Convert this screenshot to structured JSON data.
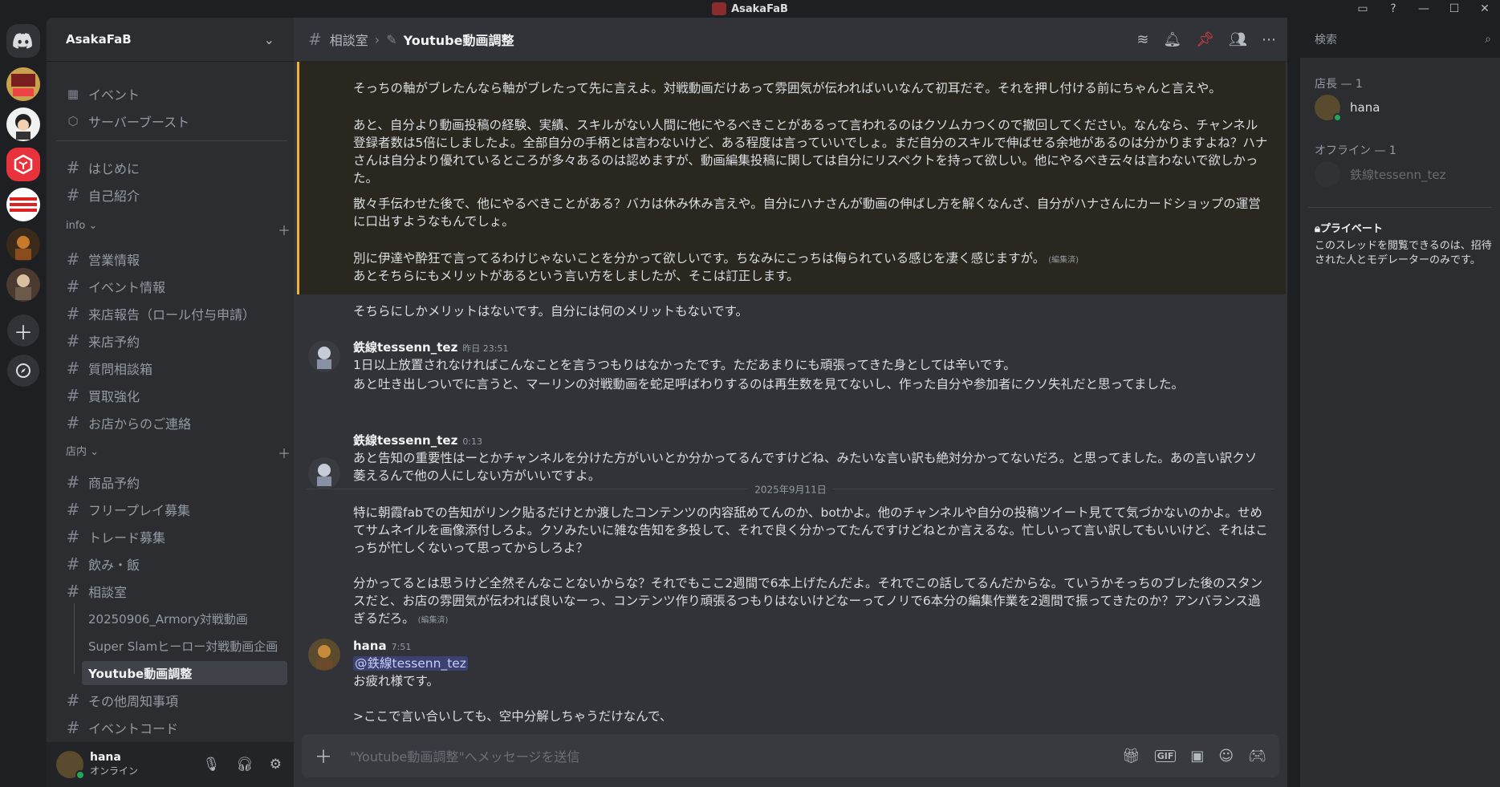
{
  "window": {
    "title": "AsakaFaB"
  },
  "server": {
    "name": "AsakaFaB"
  },
  "sidebar": {
    "top_items": [
      {
        "label": "イベント"
      },
      {
        "label": "サーバーブースト"
      }
    ],
    "channels_top": [
      {
        "label": "はじめに"
      },
      {
        "label": "自己紹介"
      }
    ],
    "cat_info": "info",
    "info_channels": [
      {
        "label": "営業情報"
      },
      {
        "label": "イベント情報"
      },
      {
        "label": "来店報告（ロール付与申請）"
      },
      {
        "label": "来店予約"
      },
      {
        "label": "質問相談箱"
      },
      {
        "label": "買取強化"
      },
      {
        "label": "お店からのご連絡"
      }
    ],
    "cat_store": "店内",
    "store_channels": [
      {
        "label": "商品予約"
      },
      {
        "label": "フリープレイ募集"
      },
      {
        "label": "トレード募集"
      },
      {
        "label": "飲み・飯"
      },
      {
        "label": "相談室"
      }
    ],
    "threads": [
      {
        "label": "20250906_Armory対戦動画"
      },
      {
        "label": "Super Slamヒーロー対戦動画企画"
      },
      {
        "label": "Youtube動画調整"
      }
    ],
    "after_channels": [
      {
        "label": "その他周知事項"
      },
      {
        "label": "イベントコード"
      }
    ]
  },
  "user_panel": {
    "name": "hana",
    "status": "オンライン"
  },
  "header": {
    "parent": "相談室",
    "thread": "Youtube動画調整"
  },
  "search": {
    "placeholder": "検索"
  },
  "messages": {
    "quoted": [
      "そっちの軸がブレたんなら軸がブレたって先に言えよ。対戦動画だけあって雰囲気が伝わればいいなんて初耳だぞ。それを押し付ける前にちゃんと言えや。",
      "あと、自分より動画投稿の経験、実績、スキルがない人間に他にやるべきことがあるって言われるのはクソムカつくので撤回してください。なんなら、チャンネル登録者数は5倍にしましたよ。全部自分の手柄とは言わないけど、ある程度は言っていいでしょ。まだ自分のスキルで伸ばせる余地があるのは分かりますよね？ハナさんは自分より優れているところが多々あるのは認めますが、動画編集投稿に関しては自分にリスペクトを持って欲しい。他にやるべき云々は言わないで欲しかった。",
      "散々手伝わせた後で、他にやるべきことがある？バカは休み休み言えや。自分にハナさんが動画の伸ばし方を解くなんざ、自分がハナさんにカードショップの運営に口出すようなもんでしょ。",
      "別に伊達や酔狂で言ってるわけじゃないことを分かって欲しいです。ちなみにこっちは侮られている感じを凄く感じますが。"
    ],
    "edited_label": "(編集済)",
    "line_a": "あとそちらにもメリットがあるという言い方をしましたが、そこは訂正します。",
    "line_b": "そちらにしかメリットはないです。自分には何のメリットもないです。",
    "m1": {
      "author": "鉄線tessenn_tez",
      "time": "昨日 23:51",
      "lines": [
        "1日以上放置されなければこんなことを言うつもりはなかったです。ただあまりにも頑張ってきた身としては辛いです。",
        "あと吐き出しついでに言うと、マーリンの対戦動画を蛇足呼ばわりするのは再生数を見てないし、作った自分や参加者にクソ失礼だと思ってました。"
      ]
    },
    "date_divider": "2025年9月11日",
    "m2": {
      "author": "鉄線tessenn_tez",
      "time": "0:13",
      "p1": "あと告知の重要性はーとかチャンネルを分けた方がいいとか分かってるんですけどね、みたいな言い訳も絶対分かってないだろ。と思ってました。あの言い訳クソ萎えるんで他の人にしない方がいいですよ。",
      "p2": "特に朝霞fabでの告知がリンク貼るだけとか渡したコンテンツの内容舐めてんのか、botかよ。他のチャンネルや自分の投稿ツイート見てて気づかないのかよ。せめてサムネイルを画像添付しろよ。クソみたいに雑な告知を多投して、それで良く分かってたんですけどねとか言えるな。忙しいって言い訳してもいいけど、それはこっちが忙しくないって思ってからしろよ？",
      "p3": "分かってるとは思うけど全然そんなことないからな？それでもここ2週間で6本上げたんだよ。それでこの話してるんだからな。ていうかそっちのブレた後のスタンスだと、お店の雰囲気が伝われば良いなーっ、コンテンツ作り頑張るつもりはないけどなーってノリで6本分の編集作業を2週間で振ってきたのか？アンバランス過ぎるだろ。"
    },
    "m3": {
      "author": "hana",
      "time": "7:51",
      "mention": "@鉄線tessenn_tez",
      "l1": "お疲れ様です。",
      "l2": ">ここで言い合いしても、空中分解しちゃうだけなんで、"
    }
  },
  "composer": {
    "placeholder": "\"Youtube動画調整\"へメッセージを送信"
  },
  "members": {
    "cat1": "店長 — 1",
    "m1": "hana",
    "cat2": "オフライン — 1",
    "m2": "鉄線tessenn_tez",
    "private_title": "プライベート",
    "private_text": "このスレッドを閲覧できるのは、招待された人とモデレーターのみです。"
  },
  "colors": {
    "accent": "#5865f2",
    "online": "#23a55a",
    "highlight": "#f0b232",
    "danger": "#f23f43"
  }
}
